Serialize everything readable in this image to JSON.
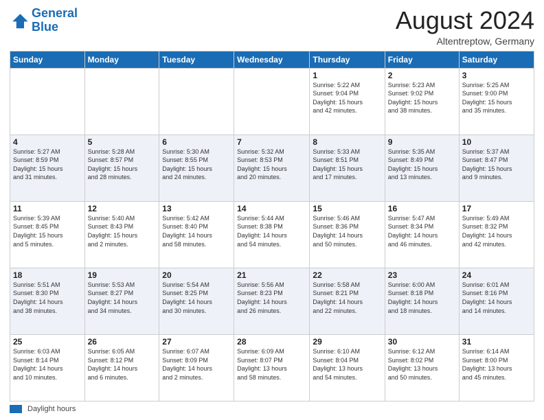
{
  "header": {
    "logo_line1": "General",
    "logo_line2": "Blue",
    "month_title": "August 2024",
    "location": "Altentreptow, Germany"
  },
  "weekdays": [
    "Sunday",
    "Monday",
    "Tuesday",
    "Wednesday",
    "Thursday",
    "Friday",
    "Saturday"
  ],
  "weeks": [
    [
      {
        "num": "",
        "info": ""
      },
      {
        "num": "",
        "info": ""
      },
      {
        "num": "",
        "info": ""
      },
      {
        "num": "",
        "info": ""
      },
      {
        "num": "1",
        "info": "Sunrise: 5:22 AM\nSunset: 9:04 PM\nDaylight: 15 hours\nand 42 minutes."
      },
      {
        "num": "2",
        "info": "Sunrise: 5:23 AM\nSunset: 9:02 PM\nDaylight: 15 hours\nand 38 minutes."
      },
      {
        "num": "3",
        "info": "Sunrise: 5:25 AM\nSunset: 9:00 PM\nDaylight: 15 hours\nand 35 minutes."
      }
    ],
    [
      {
        "num": "4",
        "info": "Sunrise: 5:27 AM\nSunset: 8:59 PM\nDaylight: 15 hours\nand 31 minutes."
      },
      {
        "num": "5",
        "info": "Sunrise: 5:28 AM\nSunset: 8:57 PM\nDaylight: 15 hours\nand 28 minutes."
      },
      {
        "num": "6",
        "info": "Sunrise: 5:30 AM\nSunset: 8:55 PM\nDaylight: 15 hours\nand 24 minutes."
      },
      {
        "num": "7",
        "info": "Sunrise: 5:32 AM\nSunset: 8:53 PM\nDaylight: 15 hours\nand 20 minutes."
      },
      {
        "num": "8",
        "info": "Sunrise: 5:33 AM\nSunset: 8:51 PM\nDaylight: 15 hours\nand 17 minutes."
      },
      {
        "num": "9",
        "info": "Sunrise: 5:35 AM\nSunset: 8:49 PM\nDaylight: 15 hours\nand 13 minutes."
      },
      {
        "num": "10",
        "info": "Sunrise: 5:37 AM\nSunset: 8:47 PM\nDaylight: 15 hours\nand 9 minutes."
      }
    ],
    [
      {
        "num": "11",
        "info": "Sunrise: 5:39 AM\nSunset: 8:45 PM\nDaylight: 15 hours\nand 5 minutes."
      },
      {
        "num": "12",
        "info": "Sunrise: 5:40 AM\nSunset: 8:43 PM\nDaylight: 15 hours\nand 2 minutes."
      },
      {
        "num": "13",
        "info": "Sunrise: 5:42 AM\nSunset: 8:40 PM\nDaylight: 14 hours\nand 58 minutes."
      },
      {
        "num": "14",
        "info": "Sunrise: 5:44 AM\nSunset: 8:38 PM\nDaylight: 14 hours\nand 54 minutes."
      },
      {
        "num": "15",
        "info": "Sunrise: 5:46 AM\nSunset: 8:36 PM\nDaylight: 14 hours\nand 50 minutes."
      },
      {
        "num": "16",
        "info": "Sunrise: 5:47 AM\nSunset: 8:34 PM\nDaylight: 14 hours\nand 46 minutes."
      },
      {
        "num": "17",
        "info": "Sunrise: 5:49 AM\nSunset: 8:32 PM\nDaylight: 14 hours\nand 42 minutes."
      }
    ],
    [
      {
        "num": "18",
        "info": "Sunrise: 5:51 AM\nSunset: 8:30 PM\nDaylight: 14 hours\nand 38 minutes."
      },
      {
        "num": "19",
        "info": "Sunrise: 5:53 AM\nSunset: 8:27 PM\nDaylight: 14 hours\nand 34 minutes."
      },
      {
        "num": "20",
        "info": "Sunrise: 5:54 AM\nSunset: 8:25 PM\nDaylight: 14 hours\nand 30 minutes."
      },
      {
        "num": "21",
        "info": "Sunrise: 5:56 AM\nSunset: 8:23 PM\nDaylight: 14 hours\nand 26 minutes."
      },
      {
        "num": "22",
        "info": "Sunrise: 5:58 AM\nSunset: 8:21 PM\nDaylight: 14 hours\nand 22 minutes."
      },
      {
        "num": "23",
        "info": "Sunrise: 6:00 AM\nSunset: 8:18 PM\nDaylight: 14 hours\nand 18 minutes."
      },
      {
        "num": "24",
        "info": "Sunrise: 6:01 AM\nSunset: 8:16 PM\nDaylight: 14 hours\nand 14 minutes."
      }
    ],
    [
      {
        "num": "25",
        "info": "Sunrise: 6:03 AM\nSunset: 8:14 PM\nDaylight: 14 hours\nand 10 minutes."
      },
      {
        "num": "26",
        "info": "Sunrise: 6:05 AM\nSunset: 8:12 PM\nDaylight: 14 hours\nand 6 minutes."
      },
      {
        "num": "27",
        "info": "Sunrise: 6:07 AM\nSunset: 8:09 PM\nDaylight: 14 hours\nand 2 minutes."
      },
      {
        "num": "28",
        "info": "Sunrise: 6:09 AM\nSunset: 8:07 PM\nDaylight: 13 hours\nand 58 minutes."
      },
      {
        "num": "29",
        "info": "Sunrise: 6:10 AM\nSunset: 8:04 PM\nDaylight: 13 hours\nand 54 minutes."
      },
      {
        "num": "30",
        "info": "Sunrise: 6:12 AM\nSunset: 8:02 PM\nDaylight: 13 hours\nand 50 minutes."
      },
      {
        "num": "31",
        "info": "Sunrise: 6:14 AM\nSunset: 8:00 PM\nDaylight: 13 hours\nand 45 minutes."
      }
    ]
  ],
  "footer": {
    "daylight_label": "Daylight hours"
  }
}
